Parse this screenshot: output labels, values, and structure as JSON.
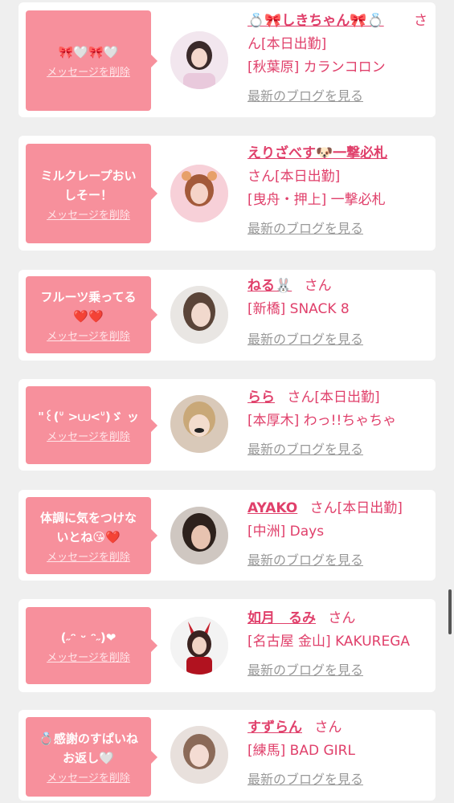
{
  "delete_label": "メッセージを削除",
  "blog_label": "最新のブログを見る",
  "san": "さん",
  "cards": [
    {
      "message": "🎀🤍🎀🤍",
      "name": "💍🎀しきちゃん🎀💍",
      "line1_suffix": "さ",
      "line2": "ん[本日出勤]",
      "shop": "[秋葉原] カランコロン"
    },
    {
      "message": "ミルクレープおい\nしそー！",
      "name": "えりざべす🐶一撃必札",
      "line2": "さん[本日出勤]",
      "shop": "[曳舟・押上] 一撃必札"
    },
    {
      "message": "フルーツ乗ってる\n❤️❤️",
      "name": "ねる🐰",
      "line1_suffix": "さん",
      "shop": "[新橋] SNACK 8"
    },
    {
      "message": "\"꒰(ᐡ >⩊<ᐡ)ゞ ッ",
      "name": "らら",
      "line1_suffix": "さん[本日出勤]",
      "shop": "[本厚木] わっ!!ちゃちゃ"
    },
    {
      "message": "体調に気をつけな\nいとね😘❤️",
      "name": "AYAKO",
      "line1_suffix": "さん[本日出勤]",
      "shop": "[中洲] Days"
    },
    {
      "message": "(˶ᵔ ᵕ ᵔ˶)❤︎",
      "name": "如月　るみ",
      "line1_suffix": "さん",
      "shop": "[名古屋 金山] KAKUREGA"
    },
    {
      "message": "💍感謝のすぱいね\nお返し🤍",
      "name": "すずらん",
      "line1_suffix": "さん",
      "shop": "[練馬] BAD GIRL"
    }
  ],
  "colors": {
    "accent": "#e0406b",
    "bubble": "#f7909c",
    "background": "#efefef"
  }
}
